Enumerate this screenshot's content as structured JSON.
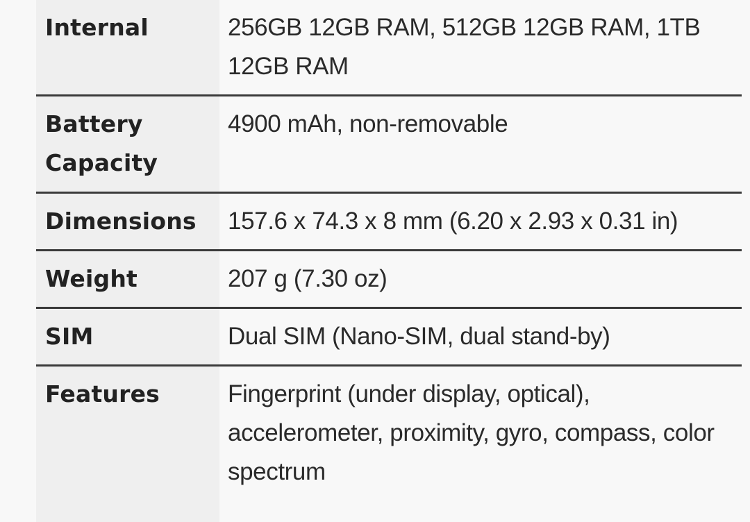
{
  "spec_table": {
    "rows": [
      {
        "label": "Internal",
        "value": "256GB 12GB RAM, 512GB 12GB RAM, 1TB 12GB RAM"
      },
      {
        "label": "Battery Capacity",
        "value": "4900 mAh, non-removable"
      },
      {
        "label": "Dimensions",
        "value": "157.6 x 74.3 x 8 mm (6.20 x 2.93 x 0.31 in)"
      },
      {
        "label": "Weight",
        "value": "207 g (7.30 oz)"
      },
      {
        "label": "SIM",
        "value": "Dual SIM (Nano-SIM, dual stand-by)"
      },
      {
        "label": "Features",
        "value": "Fingerprint (under display, optical), accelerometer, proximity, gyro, compass, color spectrum"
      }
    ]
  }
}
